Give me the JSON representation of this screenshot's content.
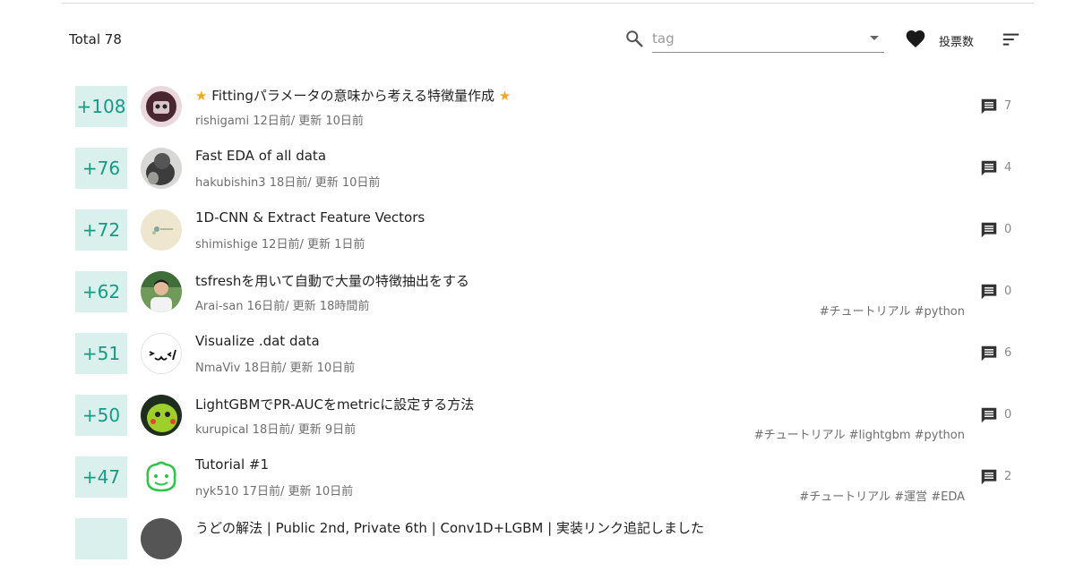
{
  "header": {
    "total_label": "Total 78",
    "search_placeholder": "tag",
    "sort_label": "投票数"
  },
  "icons": {
    "search": "search-icon",
    "dropdown": "chevron-down-icon",
    "heart": "heart-icon",
    "sort": "sort-icon",
    "comment": "comment-icon"
  },
  "colors": {
    "vote_bg": "#d9f0ec",
    "vote_text": "#179a85",
    "star": "#f5a623"
  },
  "items": [
    {
      "votes": "+108",
      "star_left": "★",
      "title": "Fittingパラメータの意味から考える特徴量作成",
      "star_right": "★",
      "meta": "rishigami 12日前/ 更新 10日前",
      "tags": "",
      "comments": "7"
    },
    {
      "votes": "+76",
      "star_left": "",
      "title": "Fast EDA of all data",
      "star_right": "",
      "meta": "hakubishin3 18日前/ 更新 10日前",
      "tags": "",
      "comments": "4"
    },
    {
      "votes": "+72",
      "star_left": "",
      "title": "1D-CNN & Extract Feature Vectors",
      "star_right": "",
      "meta": "shimishige 12日前/ 更新 1日前",
      "tags": "",
      "comments": "0"
    },
    {
      "votes": "+62",
      "star_left": "",
      "title": "tsfreshを用いて自動で大量の特徴抽出をする",
      "star_right": "",
      "meta": "Arai-san 16日前/ 更新 18時間前",
      "tags": "#チュートリアル #python",
      "comments": "0"
    },
    {
      "votes": "+51",
      "star_left": "",
      "title": "Visualize .dat data",
      "star_right": "",
      "meta": "NmaViv 18日前/ 更新 10日前",
      "tags": "",
      "comments": "6"
    },
    {
      "votes": "+50",
      "star_left": "",
      "title": "LightGBMでPR-AUCをmetricに設定する方法",
      "star_right": "",
      "meta": "kurupical 18日前/ 更新 9日前",
      "tags": "#チュートリアル #lightgbm #python",
      "comments": "0"
    },
    {
      "votes": "+47",
      "star_left": "",
      "title": "Tutorial #1",
      "star_right": "",
      "meta": "nyk510 17日前/ 更新 10日前",
      "tags": "#チュートリアル #運営 #EDA",
      "comments": "2"
    },
    {
      "votes": "",
      "star_left": "",
      "title": "うどの解法 | Public 2nd, Private 6th | Conv1D+LGBM | 実装リンク追記しました",
      "star_right": "",
      "meta": "",
      "tags": "",
      "comments": ""
    }
  ]
}
